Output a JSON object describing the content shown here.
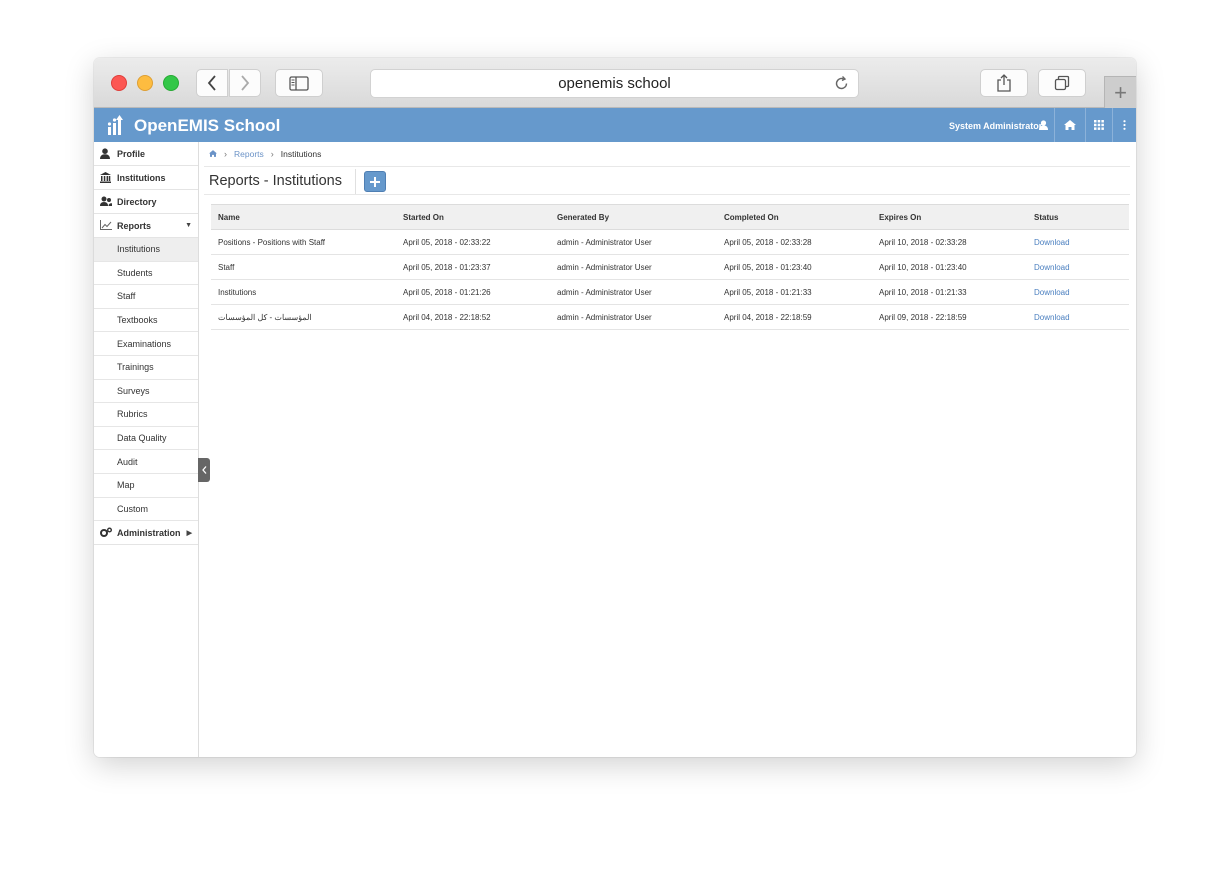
{
  "browser": {
    "url_text": "openemis school",
    "plus_label": "+"
  },
  "app": {
    "title": "OpenEMIS School",
    "user": "System Administrator",
    "brand_color": "#6699cc"
  },
  "nav": {
    "main": [
      {
        "label": "Profile",
        "icon": "user-icon"
      },
      {
        "label": "Institutions",
        "icon": "bank-icon"
      },
      {
        "label": "Directory",
        "icon": "users-icon"
      },
      {
        "label": "Reports",
        "icon": "chart-icon"
      }
    ],
    "report_items": [
      "Institutions",
      "Students",
      "Staff",
      "Textbooks",
      "Examinations",
      "Trainings",
      "Surveys",
      "Rubrics",
      "Data Quality",
      "Audit",
      "Map",
      "Custom"
    ],
    "admin_label": "Administration"
  },
  "breadcrumb": {
    "reports": "Reports",
    "current": "Institutions"
  },
  "page": {
    "title": "Reports - Institutions"
  },
  "table": {
    "headers": [
      "Name",
      "Started On",
      "Generated By",
      "Completed On",
      "Expires On",
      "Status"
    ],
    "rows": [
      [
        "Positions - Positions with Staff",
        "April 05, 2018 - 02:33:22",
        "admin - Administrator User",
        "April 05, 2018 - 02:33:28",
        "April 10, 2018 - 02:33:28",
        "Download"
      ],
      [
        "Staff",
        "April 05, 2018 - 01:23:37",
        "admin - Administrator User",
        "April 05, 2018 - 01:23:40",
        "April 10, 2018 - 01:23:40",
        "Download"
      ],
      [
        "Institutions",
        "April 05, 2018 - 01:21:26",
        "admin - Administrator User",
        "April 05, 2018 - 01:21:33",
        "April 10, 2018 - 01:21:33",
        "Download"
      ],
      [
        "المؤسسات - كل المؤسسات",
        "April 04, 2018 - 22:18:52",
        "admin - Administrator User",
        "April 04, 2018 - 22:18:59",
        "April 09, 2018 - 22:18:59",
        "Download"
      ]
    ]
  }
}
